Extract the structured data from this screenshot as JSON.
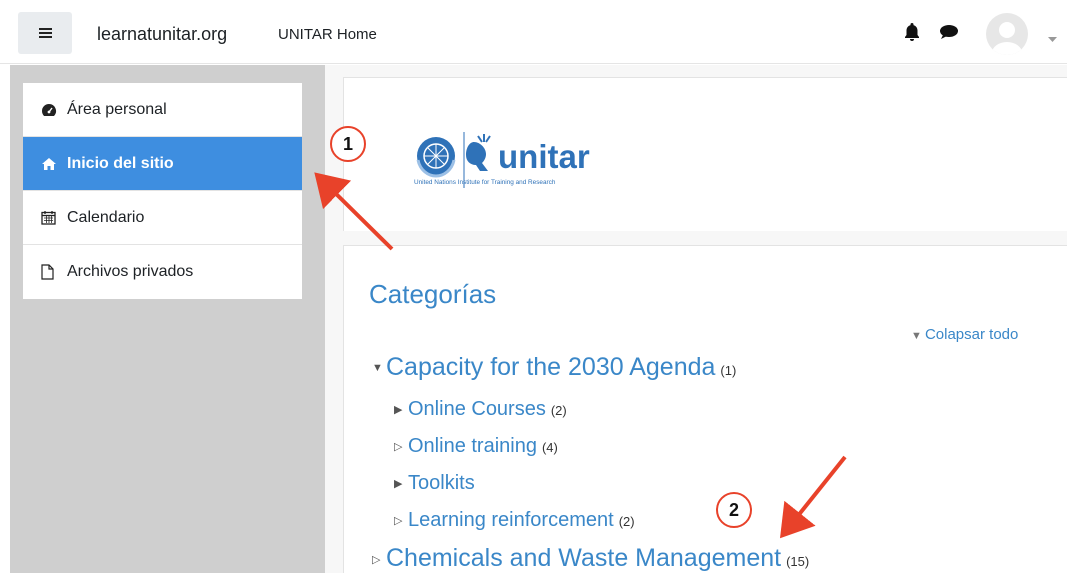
{
  "header": {
    "brand": "learnatunitar.org",
    "home_link": "UNITAR Home"
  },
  "nav": {
    "items": [
      {
        "label": "Área personal",
        "icon": "dashboard-icon",
        "active": false
      },
      {
        "label": "Inicio del sitio",
        "icon": "home-icon",
        "active": true
      },
      {
        "label": "Calendario",
        "icon": "calendar-icon",
        "active": false
      },
      {
        "label": "Archivos privados",
        "icon": "file-icon",
        "active": false
      }
    ]
  },
  "logo": {
    "wordmark": "unitar",
    "tagline": "United Nations Institute for Training and Research"
  },
  "categories": {
    "title": "Categorías",
    "collapse_all": "Colapsar todo",
    "items": [
      {
        "name": "Capacity for the 2030 Agenda",
        "count": "(1)"
      },
      {
        "name": "Online Courses",
        "count": "(2)"
      },
      {
        "name": "Online training",
        "count": "(4)"
      },
      {
        "name": "Toolkits",
        "count": ""
      },
      {
        "name": "Learning reinforcement",
        "count": "(2)"
      },
      {
        "name": "Chemicals and Waste Management",
        "count": "(15)"
      }
    ]
  },
  "annotations": {
    "badge_1": "1",
    "badge_2": "2",
    "color": "#e8422a"
  },
  "colors": {
    "accent": "#3e8ee0",
    "link": "#3a87c8"
  }
}
